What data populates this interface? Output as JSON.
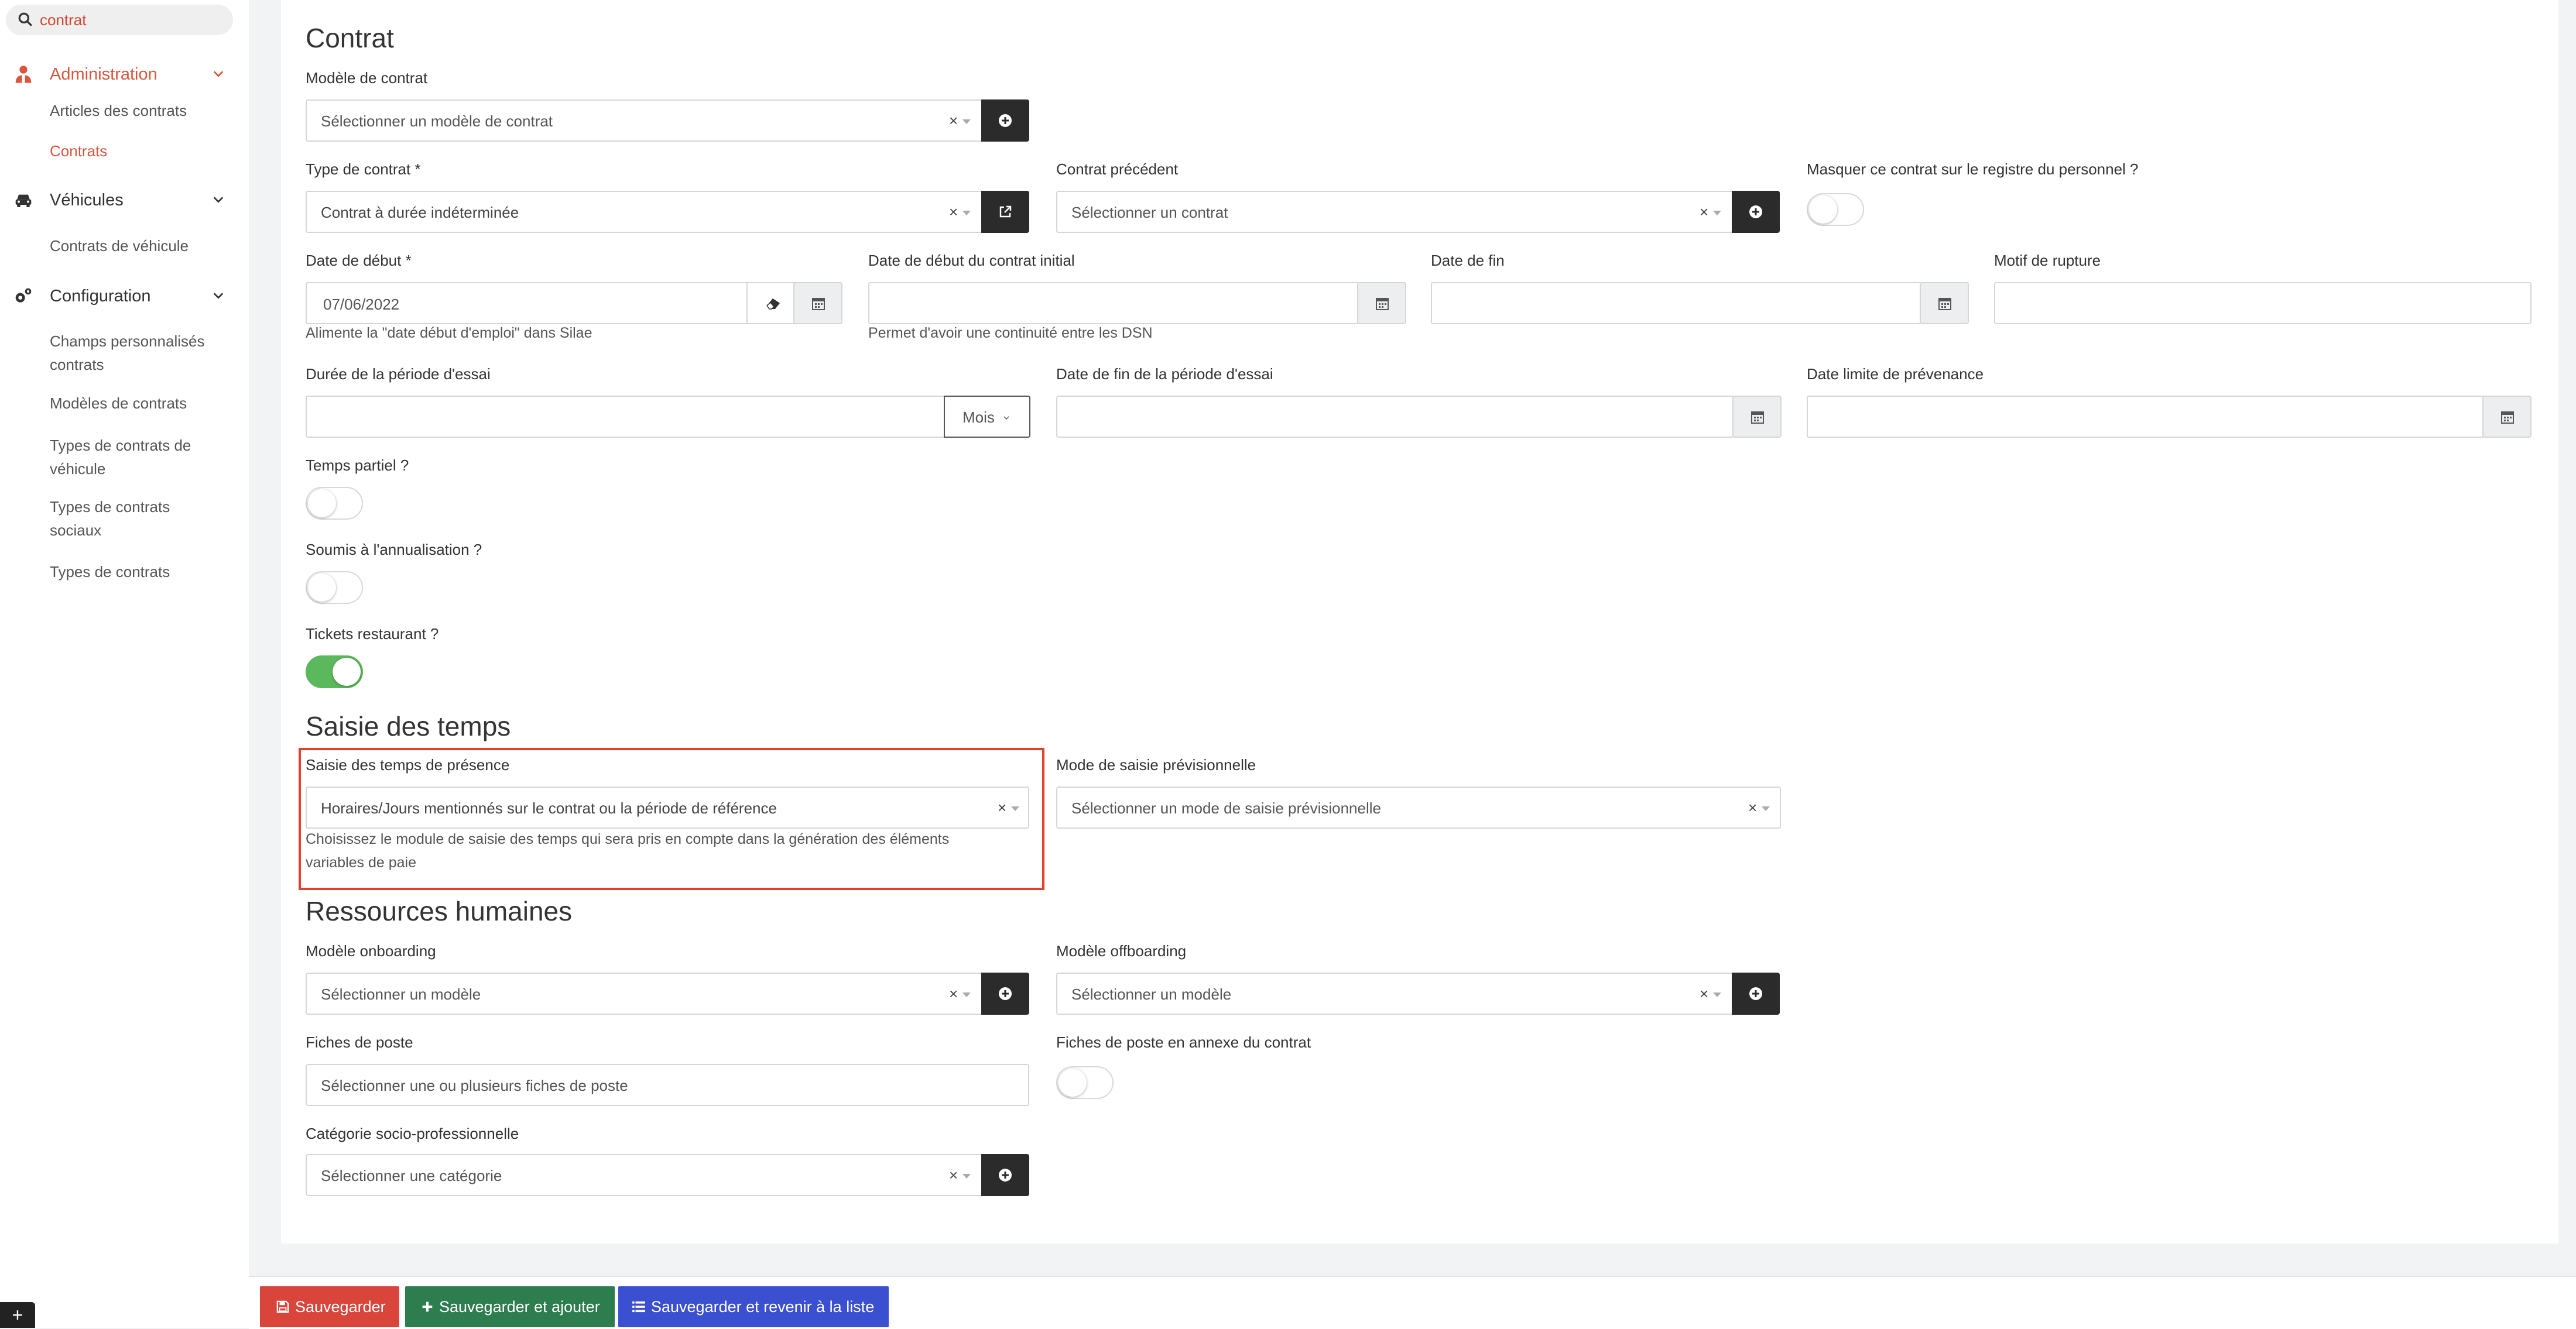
{
  "search": {
    "value": "contrat"
  },
  "sidebar": {
    "sections": [
      {
        "label": "Administration",
        "icon": "user-tie-icon",
        "items": [
          "Articles des contrats",
          "Contrats"
        ]
      },
      {
        "label": "Véhicules",
        "icon": "car-icon",
        "items": [
          "Contrats de véhicule"
        ]
      },
      {
        "label": "Configuration",
        "icon": "cogs-icon",
        "items": [
          "Champs personnalisés contrats",
          "Modèles de contrats",
          "Types de contrats de véhicule",
          "Types de contrats sociaux",
          "Types de contrats"
        ]
      }
    ]
  },
  "contrat": {
    "title": "Contrat",
    "modele_label": "Modèle de contrat",
    "modele_placeholder": "Sélectionner un modèle de contrat",
    "type_label": "Type de contrat *",
    "type_value": "Contrat à durée indéterminée",
    "precedent_label": "Contrat précédent",
    "precedent_placeholder": "Sélectionner un contrat",
    "masquer_label": "Masquer ce contrat sur le registre du personnel ?",
    "date_debut_label": "Date de début *",
    "date_debut_value": "07/06/2022",
    "date_debut_help": "Alimente la \"date début d'emploi\" dans Silae",
    "date_initial_label": "Date de début du contrat initial",
    "date_initial_help": "Permet d'avoir une continuité entre les DSN",
    "date_fin_label": "Date de fin",
    "motif_label": "Motif de rupture",
    "duree_essai_label": "Durée de la période d'essai",
    "duree_unit": "Mois",
    "fin_essai_label": "Date de fin de la période d'essai",
    "prevenance_label": "Date limite de prévenance",
    "temps_partiel_label": "Temps partiel ?",
    "annualisation_label": "Soumis à l'annualisation ?",
    "tickets_label": "Tickets restaurant ?"
  },
  "saisie": {
    "title": "Saisie des temps",
    "presence_label": "Saisie des temps de présence",
    "presence_value": "Horaires/Jours mentionnés sur le contrat ou la période de référence",
    "presence_help_1": "Choisissez le module de saisie des temps qui sera pris en compte dans la génération des éléments",
    "presence_help_2": "variables de paie",
    "mode_label": "Mode de saisie prévisionnelle",
    "mode_placeholder": "Sélectionner un mode de saisie prévisionnelle"
  },
  "rh": {
    "title": "Ressources humaines",
    "onboarding_label": "Modèle onboarding",
    "onboarding_placeholder": "Sélectionner un modèle",
    "offboarding_label": "Modèle offboarding",
    "offboarding_placeholder": "Sélectionner un modèle",
    "fiches_label": "Fiches de poste",
    "fiches_placeholder": "Sélectionner une ou plusieurs fiches de poste",
    "annexe_label": "Fiches de poste en annexe du contrat",
    "categorie_label": "Catégorie socio-professionnelle",
    "categorie_placeholder": "Sélectionner une catégorie"
  },
  "toggles": {
    "masquer": false,
    "temps_partiel": false,
    "annualisation": false,
    "tickets": true,
    "annexe": false
  },
  "footer": {
    "save": "Sauvegarder",
    "save_add": "Sauvegarder et ajouter",
    "save_back": "Sauvegarder et revenir à la liste"
  },
  "colors": {
    "accent": "#d9563d",
    "save": "#d9443b",
    "save_add": "#2e7d4f",
    "save_back": "#3b4fd1",
    "toggle_on": "#5cb85c",
    "highlight": "#e0432b"
  },
  "clear_symbol": "×",
  "plus_symbol": "+"
}
